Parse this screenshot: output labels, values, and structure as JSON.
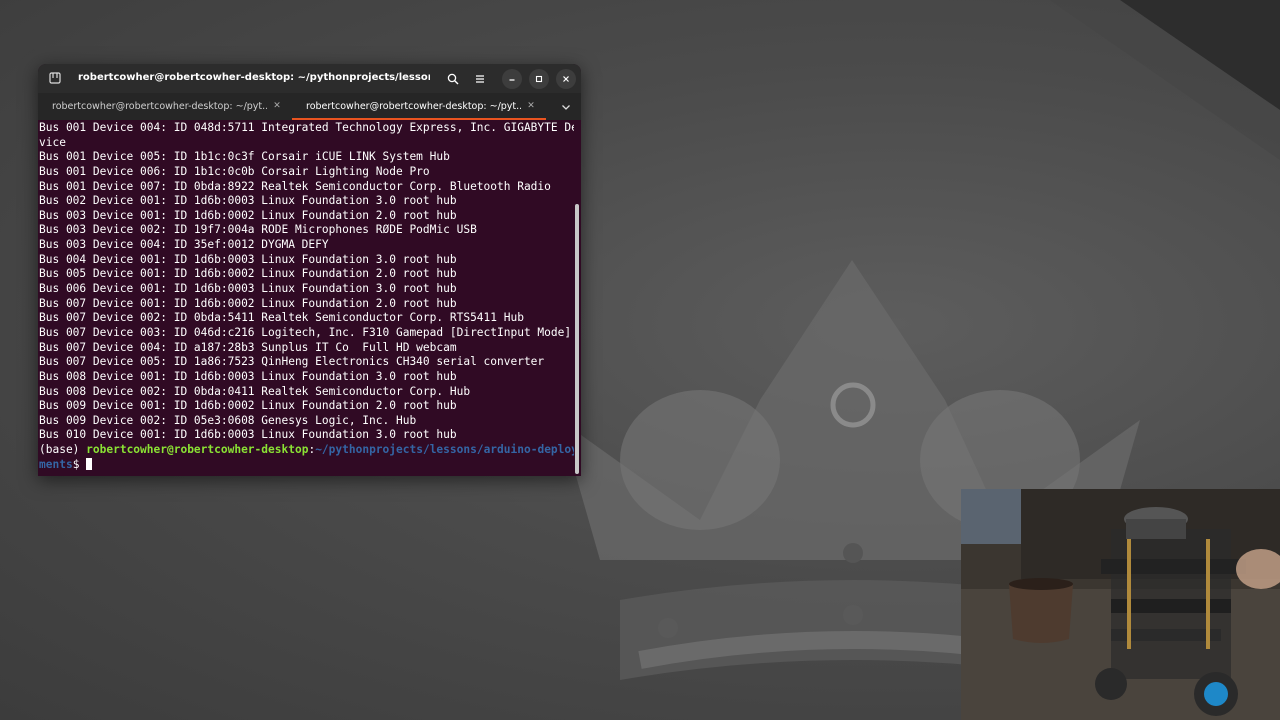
{
  "window": {
    "title": "robertcowher@robertcowher-desktop: ~/pythonprojects/lessons/arduino...",
    "tabs": [
      {
        "label": "robertcowher@robertcowher-desktop: ~/pyt...",
        "active": false
      },
      {
        "label": "robertcowher@robertcowher-desktop: ~/pyt...",
        "active": true
      }
    ]
  },
  "terminal": {
    "lines": [
      "Bus 001 Device 004: ID 048d:5711 Integrated Technology Express, Inc. GIGABYTE De",
      "vice",
      "Bus 001 Device 005: ID 1b1c:0c3f Corsair iCUE LINK System Hub",
      "Bus 001 Device 006: ID 1b1c:0c0b Corsair Lighting Node Pro",
      "Bus 001 Device 007: ID 0bda:8922 Realtek Semiconductor Corp. Bluetooth Radio",
      "Bus 002 Device 001: ID 1d6b:0003 Linux Foundation 3.0 root hub",
      "Bus 003 Device 001: ID 1d6b:0002 Linux Foundation 2.0 root hub",
      "Bus 003 Device 002: ID 19f7:004a RODE Microphones RØDE PodMic USB",
      "Bus 003 Device 004: ID 35ef:0012 DYGMA DEFY",
      "Bus 004 Device 001: ID 1d6b:0003 Linux Foundation 3.0 root hub",
      "Bus 005 Device 001: ID 1d6b:0002 Linux Foundation 2.0 root hub",
      "Bus 006 Device 001: ID 1d6b:0003 Linux Foundation 3.0 root hub",
      "Bus 007 Device 001: ID 1d6b:0002 Linux Foundation 2.0 root hub",
      "Bus 007 Device 002: ID 0bda:5411 Realtek Semiconductor Corp. RTS5411 Hub",
      "Bus 007 Device 003: ID 046d:c216 Logitech, Inc. F310 Gamepad [DirectInput Mode]",
      "Bus 007 Device 004: ID a187:28b3 Sunplus IT Co  Full HD webcam",
      "Bus 007 Device 005: ID 1a86:7523 QinHeng Electronics CH340 serial converter",
      "Bus 008 Device 001: ID 1d6b:0003 Linux Foundation 3.0 root hub",
      "Bus 008 Device 002: ID 0bda:0411 Realtek Semiconductor Corp. Hub",
      "Bus 009 Device 001: ID 1d6b:0002 Linux Foundation 2.0 root hub",
      "Bus 009 Device 002: ID 05e3:0608 Genesys Logic, Inc. Hub",
      "Bus 010 Device 001: ID 1d6b:0003 Linux Foundation 3.0 root hub"
    ],
    "prompt": {
      "env": "(base) ",
      "user_host": "robertcowher@robertcowher-desktop",
      "separator": ":",
      "path_line1": "~/pythonprojects/lessons/arduino-deploy",
      "path_line2": "ments",
      "symbol": "$ "
    }
  },
  "icons": {
    "new_tab": "new-tab-icon",
    "search": "search-icon",
    "menu": "hamburger-menu-icon",
    "minimize": "minimize-icon",
    "maximize": "maximize-icon",
    "close": "close-icon",
    "tab_list": "chevron-down-icon"
  },
  "colors": {
    "terminal_bg": "#300a24",
    "prompt_user": "#8ae234",
    "prompt_path": "#3465a4",
    "tab_accent": "#e95420"
  }
}
